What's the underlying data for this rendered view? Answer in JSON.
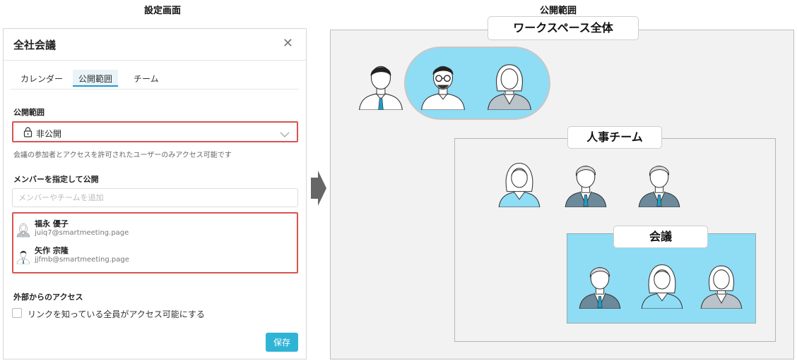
{
  "captions": {
    "settings": "設定画面",
    "scope": "公開範囲"
  },
  "panel": {
    "title": "全社会議",
    "close_icon": "close-icon",
    "tabs": [
      {
        "label": "カレンダー"
      },
      {
        "label": "公開範囲"
      },
      {
        "label": "チーム"
      }
    ],
    "active_tab": "公開範囲",
    "visibility_label": "公開範囲",
    "visibility_value": "非公開",
    "visibility_helper": "会議の参加者とアクセスを許可されたユーザーのみアクセス可能です",
    "members_label": "メンバーを指定して公開",
    "members_placeholder": "メンバーやチームを追加",
    "members": [
      {
        "name": "福永 優子",
        "email": "juiq7@smartmeeting.page"
      },
      {
        "name": "矢作 宗隆",
        "email": "jjfmb@smartmeeting.page"
      }
    ],
    "external_label": "外部からのアクセス",
    "link_checkbox_label": "リンクを知っている全員がアクセス可能にする",
    "link_checkbox_checked": false,
    "save_label": "保存"
  },
  "diagram": {
    "workspace_label": "ワークスペース全体",
    "hr_label": "人事チーム",
    "meeting_label": "会議"
  },
  "colors": {
    "accent": "#2fb4d6",
    "highlight": "#d9534f",
    "person_bg": "#8fdcf5"
  }
}
